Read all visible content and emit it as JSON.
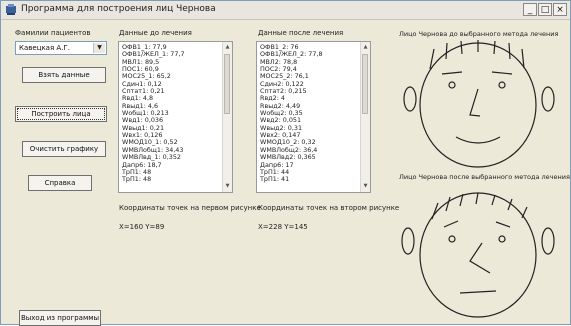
{
  "window": {
    "title": "Программа для построения лиц Чернова",
    "minimize_label": "_",
    "maximize_label": "□",
    "close_label": "×"
  },
  "patients": {
    "label": "Фамилии пациентов",
    "selected": "Кавецкая А.Г."
  },
  "buttons": {
    "take_data": "Взять данные",
    "build_faces": "Построить лица",
    "clear_graphics": "Очистить графику",
    "help": "Справка",
    "exit": "Выход из программы"
  },
  "before": {
    "label": "Данные до лечения",
    "items": [
      "ОФВ1_1:  77,9",
      "ОФВ1/ЖЕЛ_1:  77,7",
      "МВЛ1:  89,5",
      "ПОС1:  60,9",
      "МОС25_1:  65,2",
      "Сдин1:  0,12",
      "Сптат1:  0,21",
      "Rвд1:  4,8",
      "Rвыд1:  4,6",
      "Wобщ1:  0,213",
      "Wвд1:  0,036",
      "Wвыд1:  0,21",
      "Wвх1:  0,126",
      "WМОД10_1:  0,52",
      "WМВЛобщ1:  34,43",
      "WМВЛвд_1:  0,352",
      "Дапр6:  18,7",
      "ТрП1:  48",
      "ТрП1:  48"
    ],
    "coords_label": "Координаты точек на первом рисунке",
    "coords_value": "X=160 Y=89"
  },
  "after": {
    "label": "Данные после лечения",
    "items": [
      "ОФВ1_2:  76",
      "ОФВ1/ЖЕЛ_2:  77,8",
      "МВЛ2:  78,8",
      "ПОС2:  79,4",
      "МОС25_2:  76,1",
      "Сдин2:  0,122",
      "Сптат2:  0,215",
      "Rвд2:  4",
      "Rвыд2:  4,49",
      "Wобщ2:  0,35",
      "Wвд2:  0,051",
      "Wвыд2:  0,31",
      "Wвх2:  0,147",
      "WМОД10_2:  0,32",
      "WМВЛобщ2:  36,4",
      "WМВЛвд2:  0,365",
      "Дапр6:  17",
      "ТрП1:  44",
      "ТрП1:  41"
    ],
    "coords_label": "Координаты точек на втором рисунке",
    "coords_value": "X=228 Y=145"
  },
  "face_before_label": "Лицо Чернова до выбранного метода лечения",
  "face_after_label": "Лицо Чернова после выбранного метода лечения",
  "colors": {
    "window_bg": "#ece9d8",
    "line": "#222222"
  }
}
